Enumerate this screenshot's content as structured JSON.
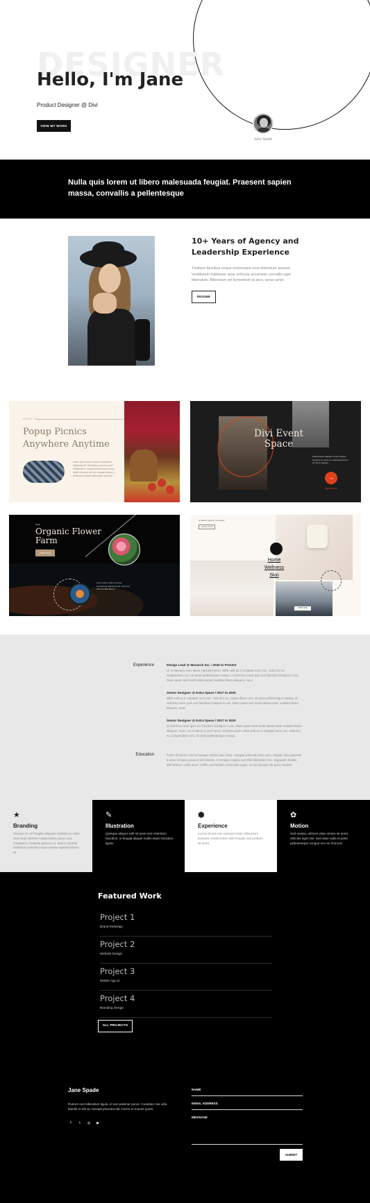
{
  "hero": {
    "bg_word": "DESIGNER",
    "title": "Hello, I'm Jane",
    "subtitle": "Product Designer @ Divi",
    "cta": "VIEW MY WORK",
    "avatar_name": "Jane Spade"
  },
  "banner": {
    "text": "Nulla quis lorem ut libero malesuada feugiat. Praesent sapien massa, convallis a pellentesque"
  },
  "about": {
    "heading": "10+ Years of Agency and Leadership Experience",
    "body": "Tristique faucibus neque scelerisque urna bibendum aenean. Vestibulum habitasse vitae vehicula accumsan convallis eget bibendum. Bibendum vel fermentum at arcu, purus amet.",
    "button": "RESUME"
  },
  "portfolio": {
    "card1": {
      "label": "ABOUT US",
      "title": "Popup Picnics Anywhere Anytime",
      "text": "Lorem ipsum dolor sit amet consectetur adipiscing elit. Sed dictum justo nec ante. Vestibulum in nisi quis felis tincidunt luctus. Morbi commodo dui sem feugiat tristique a vestibulum facilisis ullamcorper pharetra."
    },
    "card2": {
      "title": "Divi Event Space",
      "text": "Pellentesque habitant morbi tristique senectus et netus et malesuada fames ac turpis egestas.",
      "link": "READ MORE",
      "arrow": "→"
    },
    "card3": {
      "pre": "NEW",
      "title": "Organic Flower Farm",
      "button": "SHOP NOW",
      "text": "Lorem ipsum dolor sit amet, consectetur adipiscing elit. Duis sed nibh vel nibh dictum."
    },
    "card4": {
      "pre": "A Natural Organic Company",
      "mini": "LEARN MORE",
      "menu": [
        "Home",
        "Wellness",
        "Skin"
      ],
      "button": "SHOP NOW"
    }
  },
  "experience": {
    "label": "Experience",
    "items": [
      {
        "heading": "Design Lead  @  Monarch Inc.  /  2020 to Present",
        "body": "Ut a massa a, sem lacus, tincidunt proin. Nibh velit ac in volutpat nunc nec. Odio leo eu, suspendisse orci, sit amet pellentesque massa, id velit hac tortor quis orci faucibus tristique in orci. Diam quam sed morbi ullamcorper sodales libero aliquam, nunc."
      },
      {
        "heading": "Senior Designer  @  Extra Space  /  2017 to 2020",
        "body": "Nibh velit ac in volutpat nunc nec. Odio leo eu, suspendisse orci, sit amet pellentesque massa, id velit hac tortor quis orci faucibus tristique in orci. Diam quam sed morbi ullamcorper sodales libero aliquam, nunc."
      },
      {
        "heading": "Senior Designer  @  Extra Space  /  2017 to 2020",
        "body": "Id velit hac tortor quis orci faucibus tristique in orci. Diam quam sed morbi ullamcorper sodales libero aliquam, nunc. Ut a massa a, sem lacus, tincidunt proin. Nibh velit ac in volutpat nunc nec. Odio leo eu, suspendisse orci, sit amet pellentesque massa."
      }
    ],
    "education_label": "Education",
    "education_body": "Tortor rhoncus in lacus semper. Morbi vitae vitae, volutpat vehicula enim nunc, feugiat. Non placerat a amet in fusce purus id nisl viverra. At tempus magna sed nibh bibendum nec. Dignissim facilisi. Elementum mollis amet, mollis erat facilisis commodo quam. Ut dui quisque elit purus laoreet."
  },
  "services": [
    {
      "icon": "★",
      "icon_name": "star-icon",
      "title": "Branding",
      "body": "Semper id vel fringilla aliquam sodales eu nulla. Sed turpis laoreet suspendisse purus orci, volutpat in molestie pretium et, donec lobortis. Habitant a blandit neque massa egestas libero et."
    },
    {
      "icon": "✎",
      "icon_name": "pen-icon",
      "title": "Illustration",
      "body": "Quisque aliquet velit sit amet sem interdum faucibus. In feugiat aliquet mollis etiam tincidunt ligula."
    },
    {
      "icon": "⬢",
      "icon_name": "shapes-icon",
      "title": "Experience",
      "body": "Luctus lectus non quisque turpis bibendum posuere. Morbi tortor nibh fringilla sed pretium sit amet."
    },
    {
      "icon": "✿",
      "icon_name": "motion-icon",
      "title": "Motion",
      "body": "Sed massa, ultrices vitae ornare sit amet, ultricies eget nisl. Sed vitae nulla et justo pellentesque congue nec ex rhoncus."
    }
  ],
  "featured": {
    "title": "Featured Work",
    "projects": [
      {
        "name": "Project 1",
        "category": "Brand Redesign"
      },
      {
        "name": "Project 2",
        "category": "Website Design"
      },
      {
        "name": "Project 3",
        "category": "Mobile App UI"
      },
      {
        "name": "Project 4",
        "category": "Branding Design"
      }
    ],
    "button": "ALL PROJECTS"
  },
  "footer": {
    "name": "Jane Spade",
    "body": "Rutrum non bibendum ligula, in non pulvinar purus. Curabitur nisi odio, blandit et elit at, suscipit pharetra elit. Fusce ut mauris quam.",
    "social": [
      "f",
      "t",
      "◎",
      "▶"
    ],
    "fields": {
      "name": "NAME",
      "email": "EMAIL ADDRESS",
      "message": "MESSAGE"
    },
    "submit": "SUBMIT"
  },
  "colors": {
    "accent": "#e0401a",
    "dark": "#000000",
    "light_gray": "#e8e8e8"
  }
}
